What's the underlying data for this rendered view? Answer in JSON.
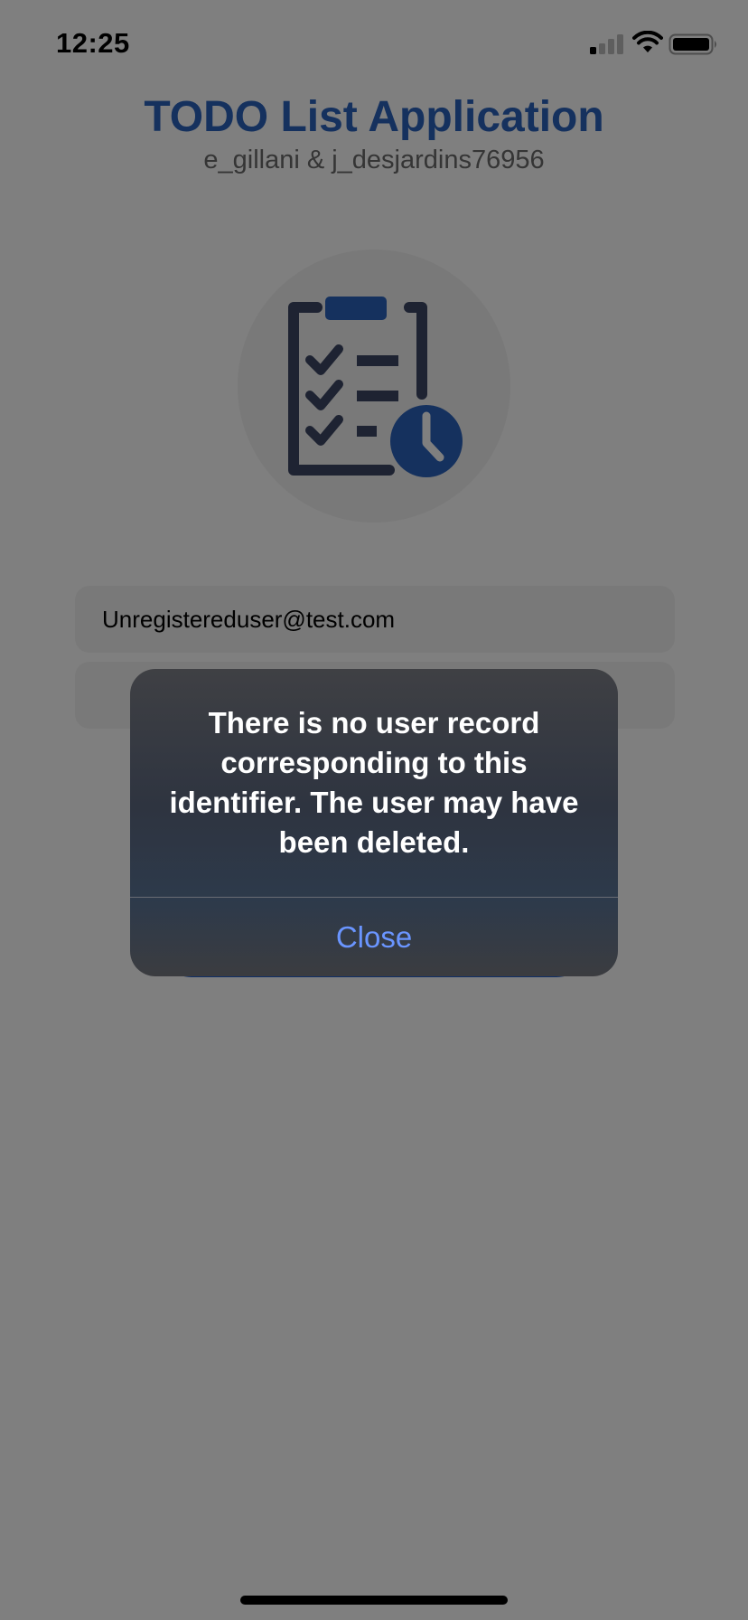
{
  "status_bar": {
    "time": "12:25",
    "icons": [
      "cellular-signal-icon",
      "wifi-icon",
      "battery-icon"
    ]
  },
  "header": {
    "title": "TODO List Application",
    "subtitle": "e_gillani & j_desjardins76956"
  },
  "logo": {
    "icon": "clipboard-checklist-clock-icon"
  },
  "form": {
    "email_value": "Unregistereduser@test.com"
  },
  "alert": {
    "message": "There is no user record corresponding to this identifier. The user may have been deleted.",
    "close_label": "Close"
  },
  "colors": {
    "title": "#2a62bd",
    "accent": "#1f5fd1",
    "alert_action": "#6a95ff"
  }
}
